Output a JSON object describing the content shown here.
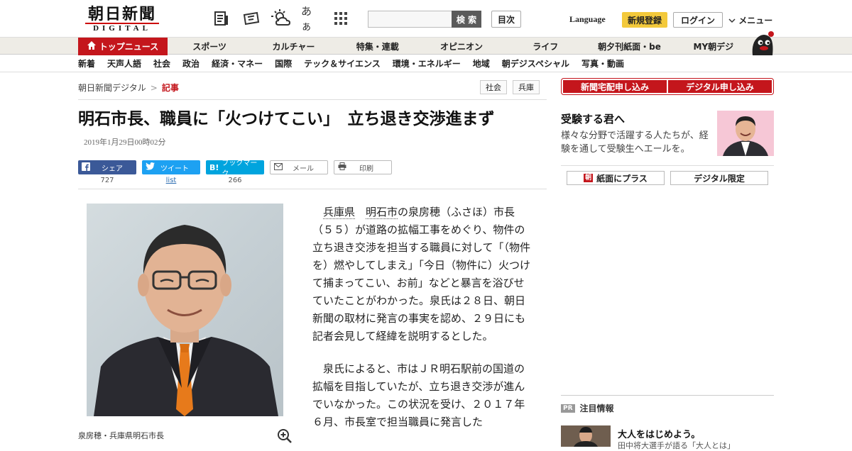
{
  "header": {
    "logo_main": "朝日新聞",
    "logo_sub": "DIGITAL",
    "kana_icon": "あぁ",
    "search_placeholder": "",
    "search_button": "検 索",
    "mokuji": "目次",
    "language": "Language",
    "register": "新規登録",
    "login": "ログイン",
    "menu": "メニュー"
  },
  "nav_primary": {
    "top": "トップニュース",
    "items": [
      "スポーツ",
      "カルチャー",
      "特集・連載",
      "オピニオン",
      "ライフ",
      "朝夕刊紙面・be",
      "MY朝デジ"
    ]
  },
  "nav_secondary": {
    "items": [
      "新着",
      "天声人語",
      "社会",
      "政治",
      "経済・マネー",
      "国際",
      "テック＆サイエンス",
      "環境・エネルギー",
      "地域",
      "朝デジスペシャル",
      "写真・動画"
    ]
  },
  "breadcrumb": {
    "home": "朝日新聞デジタル",
    "sep": ">",
    "current": "記事"
  },
  "tags": [
    "社会",
    "兵庫"
  ],
  "article": {
    "title": "明石市長、職員に「火つけてこい」　立ち退き交渉進まず",
    "date": "2019年1月29日00時02分",
    "share": {
      "facebook": {
        "label": "シェア",
        "count": "727"
      },
      "twitter": {
        "label": "ツイート",
        "count": "list"
      },
      "hatena": {
        "label": "ブックマーク",
        "count": "266"
      },
      "mail": {
        "label": "メール"
      },
      "print": {
        "label": "印刷"
      }
    },
    "caption": "泉房穂・兵庫県明石市長",
    "p1_kw1": "兵庫県",
    "p1_kw2": "明石市",
    "p1_rest": "の泉房穂（ふさほ）市長（５５）が道路の拡幅工事をめぐり、物件の立ち退き交渉を担当する職員に対して「（物件を）燃やしてしまえ」「今日（物件に）火つけて捕まってこい、お前」などと暴言を浴びせていたことがわかった。泉氏は２８日、朝日新聞の取材に発言の事実を認め、２９日にも記者会見して経緯を説明するとした。",
    "p2": "泉氏によると、市はＪＲ明石駅前の国道の拡幅を目指していたが、立ち退き交渉が進んでいなかった。この状況を受け、２０１７年６月、市長室で担当職員に発言した"
  },
  "sidebar": {
    "btn_home": "新聞宅配申し込み",
    "btn_digital": "デジタル申し込み",
    "promo_title": "受験する君へ",
    "promo_text": "様々な分野で活躍する人たちが、経験を通して受験生へエールを。",
    "plus": "紙面にプラス",
    "plus_badge": "朝",
    "digital_only": "デジタル限定",
    "pr_badge": "PR",
    "pr_label": "注目情報",
    "pr_headline": "大人をはじめよう。",
    "pr_sub": "田中将大選手が語る「大人とは」"
  },
  "colors": {
    "brand_red": "#c4161c",
    "accent_yellow": "#f3c93b",
    "facebook": "#3b5998",
    "twitter": "#1da1f2",
    "hatena": "#00a4de"
  }
}
